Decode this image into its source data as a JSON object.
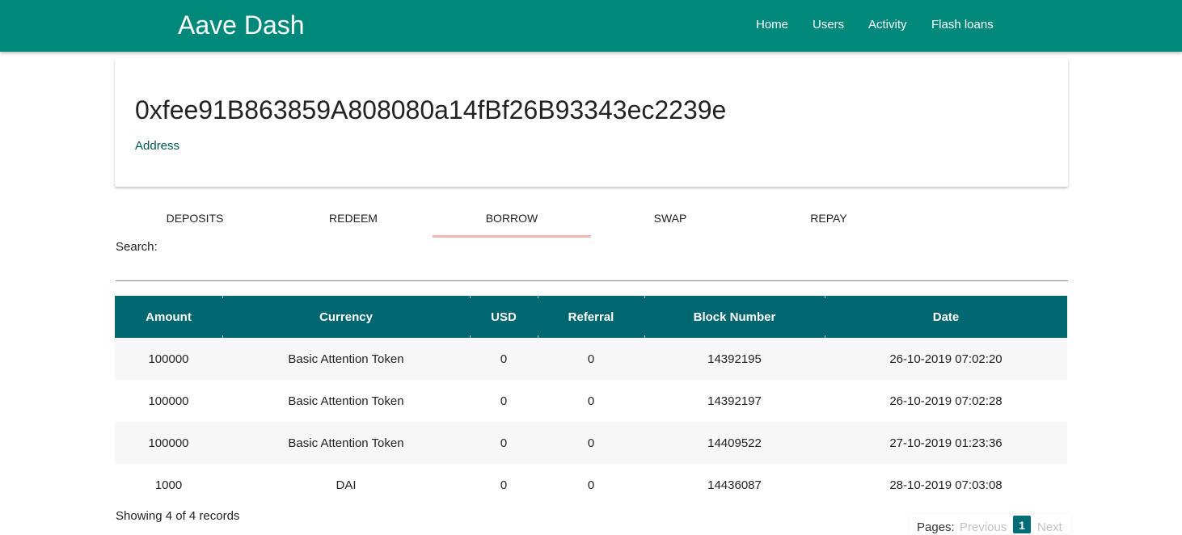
{
  "app": {
    "title": "Aave Dash"
  },
  "nav": {
    "items": [
      "Home",
      "Users",
      "Activity",
      "Flash loans"
    ]
  },
  "account": {
    "address": "0xfee91B863859A808080a14fBf26B93343ec2239e",
    "address_label": "Address"
  },
  "tabs": {
    "items": [
      "DEPOSITS",
      "REDEEM",
      "BORROW",
      "SWAP",
      "REPAY"
    ],
    "active": "BORROW"
  },
  "search": {
    "label": "Search:",
    "value": ""
  },
  "table": {
    "columns": [
      "Amount",
      "Currency",
      "USD",
      "Referral",
      "Block Number",
      "Date"
    ],
    "rows": [
      [
        "100000",
        "Basic Attention Token",
        "0",
        "0",
        "14392195",
        "26-10-2019 07:02:20"
      ],
      [
        "100000",
        "Basic Attention Token",
        "0",
        "0",
        "14392197",
        "26-10-2019 07:02:28"
      ],
      [
        "100000",
        "Basic Attention Token",
        "0",
        "0",
        "14409522",
        "27-10-2019 01:23:36"
      ],
      [
        "1000",
        "DAI",
        "0",
        "0",
        "14436087",
        "28-10-2019 07:03:08"
      ]
    ]
  },
  "footer": {
    "records_text": "Showing 4 of 4 records",
    "pages_label": "Pages:",
    "previous_label": "Previous",
    "current_page": "1",
    "next_label": "Next"
  },
  "colors": {
    "header_bg": "#00897b",
    "table_header_bg": "#00666f",
    "tab_indicator": "#f5b5b5",
    "address_label": "#00574f"
  }
}
